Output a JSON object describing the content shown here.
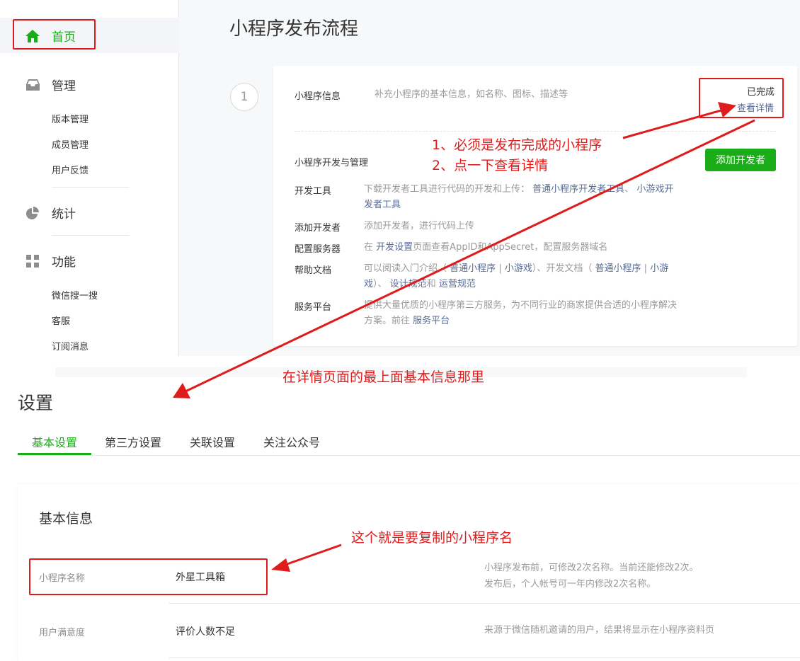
{
  "sidebar": {
    "home": "首页",
    "manage": "管理",
    "manage_items": [
      "版本管理",
      "成员管理",
      "用户反馈"
    ],
    "stats": "统计",
    "features": "功能",
    "feature_items": [
      "微信搜一搜",
      "客服",
      "订阅消息"
    ]
  },
  "process": {
    "title": "小程序发布流程",
    "step": "1",
    "info_label": "小程序信息",
    "info_desc": "补充小程序的基本信息，如名称、图标、描述等",
    "status": "已完成",
    "view_details": "查看详情",
    "dev_label": "小程序开发与管理",
    "add_dev_button": "添加开发者",
    "rows": [
      {
        "label": "开发工具",
        "pre": "下载开发者工具进行代码的开发和上传：",
        "link1": "普通小程序开发者工具",
        "mid": "、",
        "link2a": "小游戏开",
        "link2b": "发者工具"
      },
      {
        "label": "添加开发者",
        "text": "添加开发者，进行代码上传"
      },
      {
        "label": "配置服务器",
        "pre": "在",
        "link": "开发设置",
        "post": "页面查看AppID和AppSecret，配置服务器域名"
      },
      {
        "label": "帮助文档",
        "l1_pre": "可以阅读入门介绍（",
        "l1_a": "普通小程序",
        "sep": "|",
        "l1_b": "小游戏",
        "l1_mid": "）、开发文档（",
        "l1_c": "普通小程序",
        "l1_d": "小游",
        "l2_a": "戏",
        "l2_mid": "）、",
        "l2_b": "设计规范",
        "l2_and": "和",
        "l2_c": "运营规范"
      },
      {
        "label": "服务平台",
        "line1": "提供大量优质的小程序第三方服务，为不同行业的商家提供合适的小程序解决",
        "line2_pre": "方案。前往",
        "link": "服务平台"
      }
    ]
  },
  "settings": {
    "title": "设置",
    "tabs": [
      "基本设置",
      "第三方设置",
      "关联设置",
      "关注公众号"
    ],
    "section_title": "基本信息",
    "name_label": "小程序名称",
    "name_value": "外星工具箱",
    "name_desc_1": "小程序发布前，可修改2次名称。当前还能修改2次。",
    "name_desc_2": "发布后，个人帐号可一年内修改2次名称。",
    "satisfaction_label": "用户满意度",
    "satisfaction_value": "评价人数不足",
    "satisfaction_desc": "来源于微信随机邀请的用户，结果将显示在小程序资料页"
  },
  "annotations": {
    "note1": "1、必须是发布完成的小程序",
    "note2": "2、点一下查看详情",
    "note3": "在详情页面的最上面基本信息那里",
    "note4": "这个就是要复制的小程序名"
  },
  "colors": {
    "accent": "#1aad19",
    "link": "#576b95",
    "annotation": "#e01b1b"
  }
}
